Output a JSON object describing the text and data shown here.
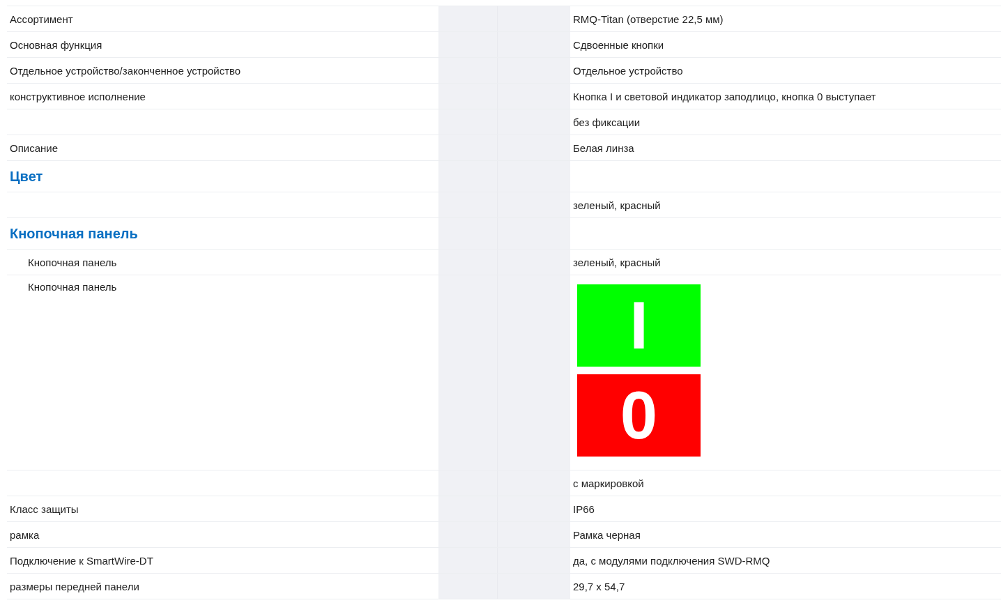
{
  "rows": [
    {
      "kind": "text",
      "label": "Ассортимент",
      "value": "RMQ-Titan (отверстие 22,5 мм)"
    },
    {
      "kind": "text",
      "label": "Основная функция",
      "value": "Сдвоенные кнопки"
    },
    {
      "kind": "text",
      "label": "Отдельное устройство/законченное устройство",
      "value": "Отдельное устройство"
    },
    {
      "kind": "text",
      "label": "конструктивное исполнение",
      "value": "Кнопка I и световой индикатор заподлицо, кнопка 0 выступает"
    },
    {
      "kind": "text",
      "value": "без фиксации"
    },
    {
      "kind": "text",
      "label": "Описание",
      "value": "Белая линза"
    },
    {
      "kind": "heading",
      "label": "Цвет"
    },
    {
      "kind": "text",
      "value": "зеленый, красный"
    },
    {
      "kind": "heading",
      "label": "Кнопочная панель"
    },
    {
      "kind": "sub",
      "label": "Кнопочная панель",
      "value": "зеленый, красный"
    },
    {
      "kind": "image",
      "label": "Кнопочная панель",
      "buttons": [
        {
          "symbol": "I",
          "color": "#00ff00"
        },
        {
          "symbol": "0",
          "color": "#ff0000"
        }
      ]
    },
    {
      "kind": "text",
      "value": "с маркировкой"
    },
    {
      "kind": "text",
      "label": "Класс защиты",
      "value": "IP66"
    },
    {
      "kind": "text",
      "label": "рамка",
      "value": "Рамка черная"
    },
    {
      "kind": "text",
      "label": "Подключение к SmartWire-DT",
      "value": "да, с модулями подключения SWD-RMQ"
    },
    {
      "kind": "text",
      "label": "размеры передней панели",
      "value": "29,7 x 54,7"
    }
  ]
}
